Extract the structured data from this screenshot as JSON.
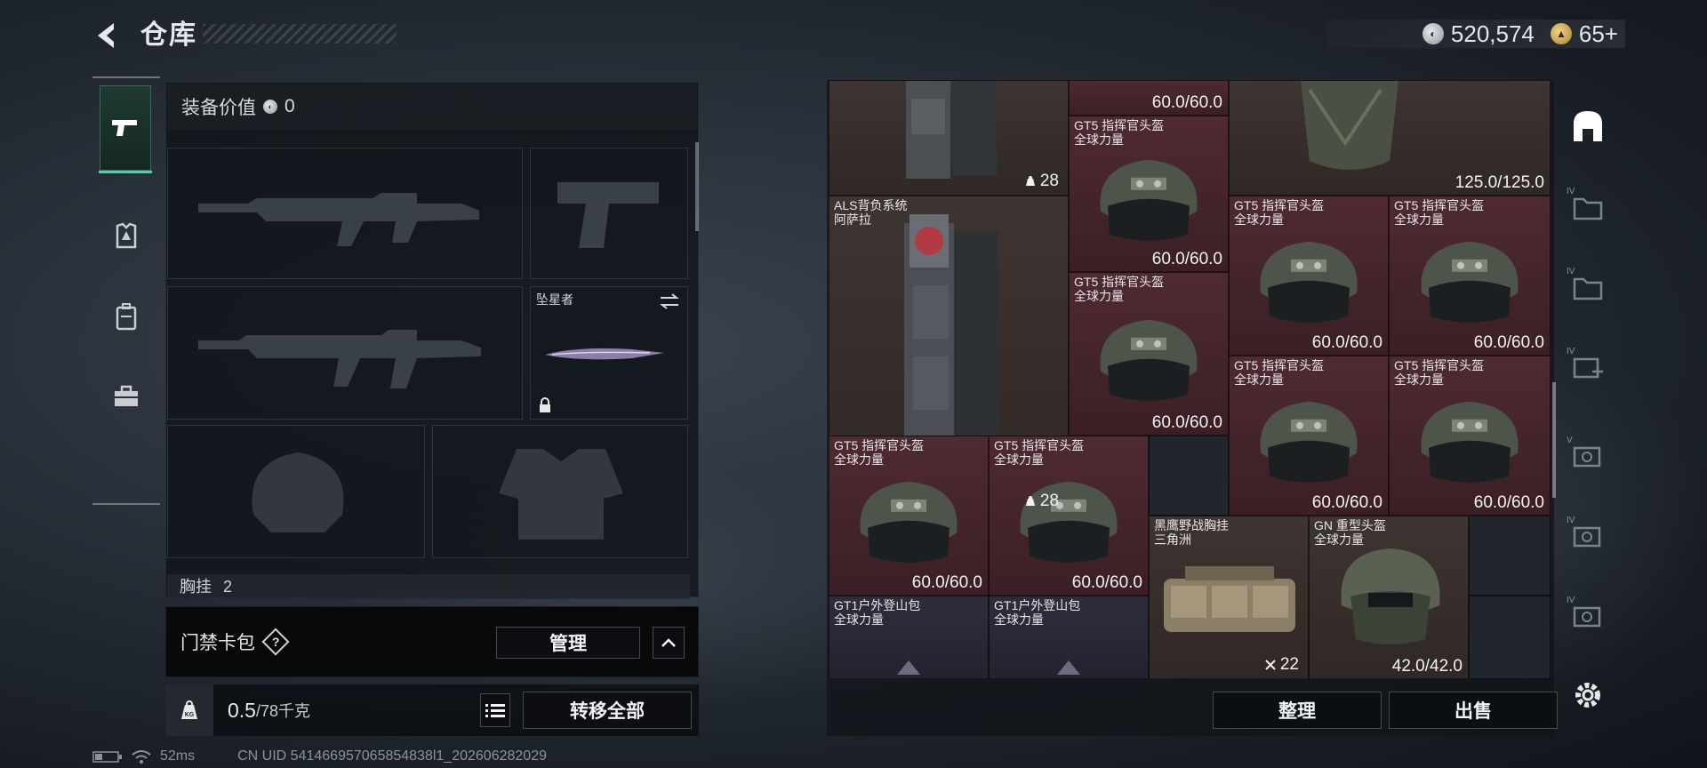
{
  "header": {
    "title": "仓库",
    "currency_main": "520,574",
    "currency_premium": "65+"
  },
  "nav": [
    "pistol-icon",
    "armor-icon",
    "backpack-icon",
    "toolbox-icon"
  ],
  "loadout": {
    "equip_value_label": "装备价值",
    "equip_value": "0",
    "melee_name": "坠星者",
    "chest_rig_label": "胸挂",
    "chest_rig_count": "2",
    "keycard_label": "门禁卡包",
    "manage_label": "管理",
    "weight_current": "0.5",
    "weight_max": "/78千克",
    "transfer_all": "转移全部"
  },
  "stash": {
    "items": [
      {
        "id": "backpack-top",
        "name": "",
        "sub": "",
        "count": "28"
      },
      {
        "id": "helmet-top",
        "dur": "60.0/60.0"
      },
      {
        "id": "armor-top",
        "dur": "125.0/125.0"
      },
      {
        "id": "helmet-a",
        "name": "GT5 指挥官头盔",
        "sub": "全球力量",
        "dur": "60.0/60.0"
      },
      {
        "id": "als",
        "name": "ALS背负系统",
        "sub": "阿萨拉",
        "count": "28"
      },
      {
        "id": "helmet-b",
        "name": "GT5 指挥官头盔",
        "sub": "全球力量",
        "dur": "60.0/60.0"
      },
      {
        "id": "helmet-c",
        "name": "GT5 指挥官头盔",
        "sub": "全球力量",
        "dur": "60.0/60.0"
      },
      {
        "id": "helmet-d",
        "name": "GT5 指挥官头盔",
        "sub": "全球力量",
        "dur": "60.0/60.0"
      },
      {
        "id": "helmet-e",
        "name": "GT5 指挥官头盔",
        "sub": "全球力量",
        "dur": "60.0/60.0"
      },
      {
        "id": "helmet-f",
        "name": "GT5 指挥官头盔",
        "sub": "全球力量",
        "dur": "60.0/60.0"
      },
      {
        "id": "helmet-g",
        "name": "GT5 指挥官头盔",
        "sub": "全球力量",
        "dur": "60.0/60.0"
      },
      {
        "id": "helmet-h",
        "name": "GT5 指挥官头盔",
        "sub": "全球力量",
        "dur": "60.0/60.0"
      },
      {
        "id": "rig",
        "name": "黑鹰野战胸挂",
        "sub": "三角洲",
        "count": "22"
      },
      {
        "id": "gn",
        "name": "GN 重型头盔",
        "sub": "全球力量",
        "dur": "42.0/42.0"
      },
      {
        "id": "gt1-a",
        "name": "GT1户外登山包",
        "sub": "全球力量"
      },
      {
        "id": "gt1-b",
        "name": "GT1户外登山包",
        "sub": "全球力量"
      }
    ],
    "sort_label": "整理",
    "sell_label": "出售"
  },
  "status": {
    "ping": "52ms",
    "uid": "CN UID 541466957065854838l1_202606282029"
  },
  "tools": [
    "home-icon",
    "folder-icon",
    "folder-icon",
    "add-icon",
    "scan-icon",
    "scan-icon",
    "scan-icon"
  ],
  "colors": {
    "accent": "#4fd0a8",
    "rarity_red": "#4e2a31",
    "rarity_purple": "#2f2c3c"
  }
}
